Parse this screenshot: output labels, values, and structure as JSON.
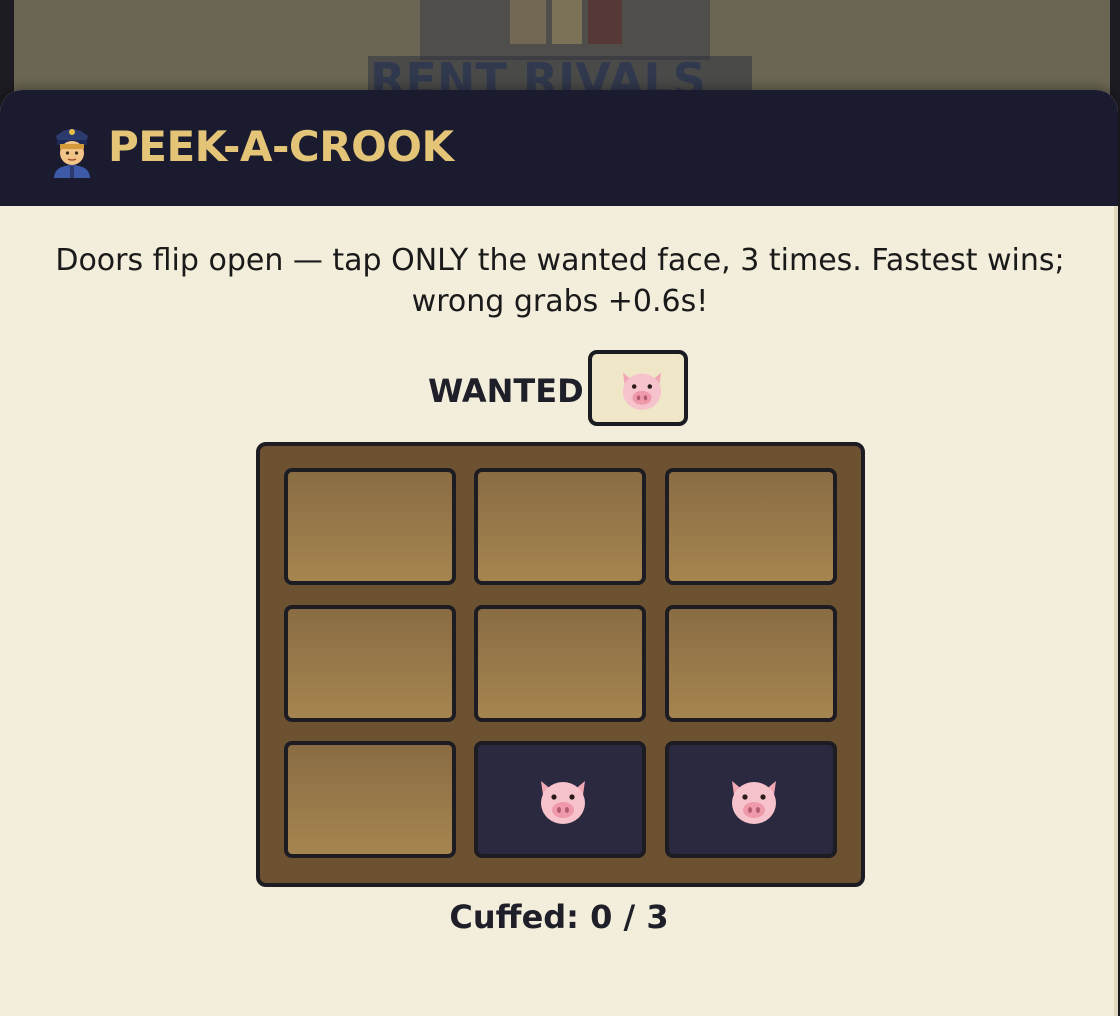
{
  "background": {
    "logo_text": "RENT RIVALS",
    "logo_colors": {
      "rent": "#2b3550",
      "rivals": "#c6362b"
    }
  },
  "modal": {
    "header_icon": "police-officer-icon",
    "title": "PEEK-A-CROOK",
    "instructions": "Doors flip open — tap ONLY the wanted face, 3 times. Fastest wins; wrong grabs +0.6s!",
    "wanted": {
      "label": "WANTED",
      "face_icon": "pig-face-icon"
    },
    "doors": [
      {
        "state": "closed",
        "face_icon": ""
      },
      {
        "state": "closed",
        "face_icon": ""
      },
      {
        "state": "closed",
        "face_icon": ""
      },
      {
        "state": "closed",
        "face_icon": ""
      },
      {
        "state": "closed",
        "face_icon": ""
      },
      {
        "state": "closed",
        "face_icon": ""
      },
      {
        "state": "closed",
        "face_icon": ""
      },
      {
        "state": "open",
        "face_icon": "pig-face-icon"
      },
      {
        "state": "open",
        "face_icon": "pig-face-icon"
      }
    ],
    "cuffed_text": "Cuffed: 0 / 3",
    "cuffed_count": 0,
    "cuffed_target": 3
  },
  "colors": {
    "header_bg": "#1b1b2f",
    "title_gold": "#e4c477",
    "panel_cream": "#f3eedb",
    "door_wood": "#9a7a4a",
    "door_open_navy": "#2a2940",
    "board_brown": "#6d5232"
  }
}
